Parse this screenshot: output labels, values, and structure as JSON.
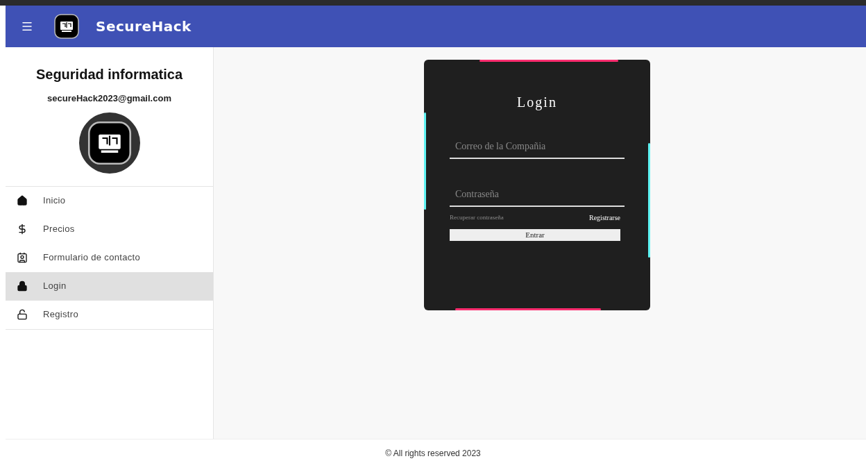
{
  "header": {
    "title": "SecureHack"
  },
  "sidebar": {
    "title": "Seguridad informatica",
    "email": "secureHack2023@gmail.com",
    "nav": [
      {
        "label": "Inicio",
        "selected": false
      },
      {
        "label": "Precios",
        "selected": false
      },
      {
        "label": "Formulario de contacto",
        "selected": false
      },
      {
        "label": "Login",
        "selected": true
      },
      {
        "label": "Registro",
        "selected": false
      }
    ]
  },
  "login": {
    "title": "Login",
    "fields": [
      {
        "placeholder": "Correo de la Compañia"
      },
      {
        "placeholder": "Contraseña"
      }
    ],
    "recover_link": "Recuperar contraseña",
    "register_link": "Registrarse",
    "submit": "Entrar"
  },
  "footer": "© All rights reserved 2023"
}
